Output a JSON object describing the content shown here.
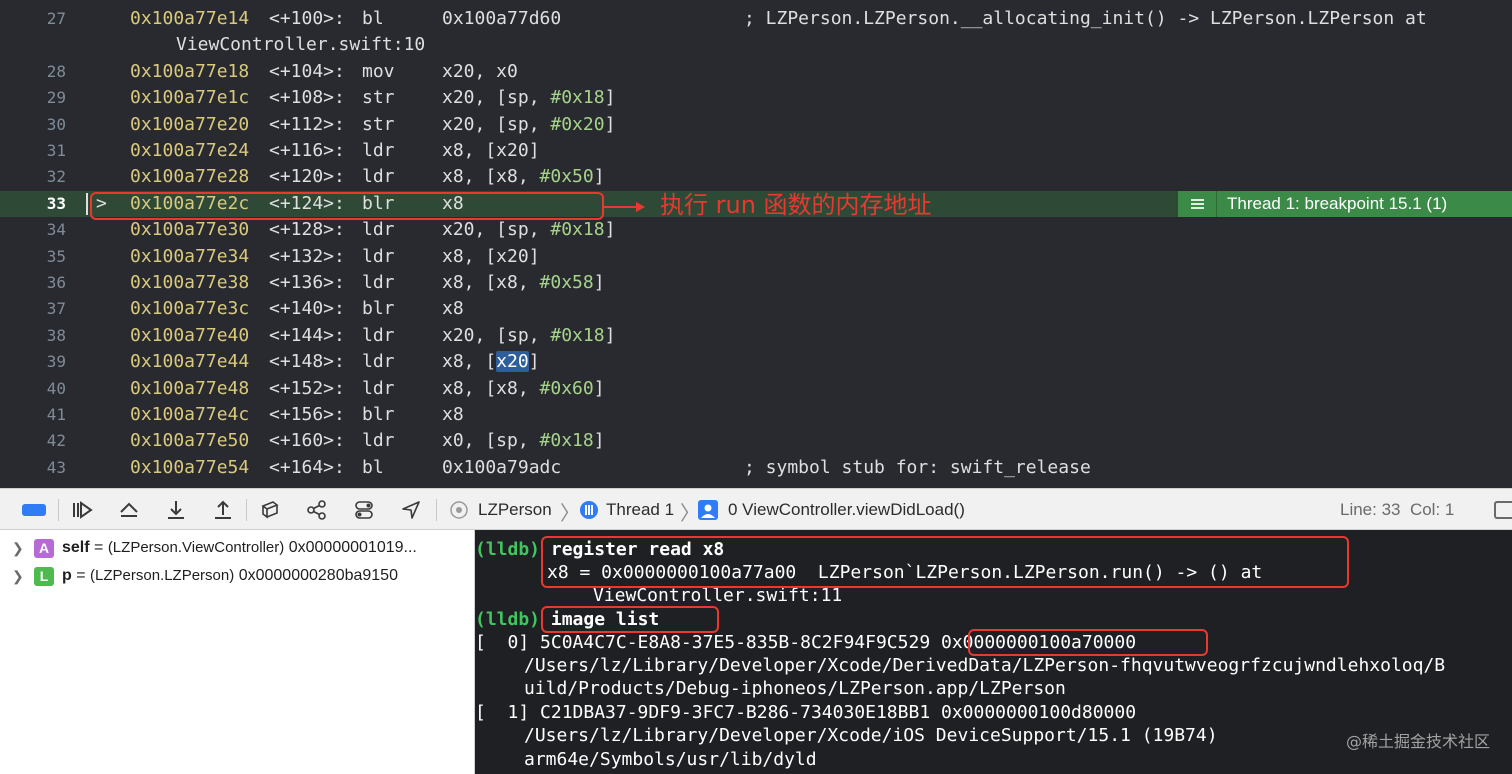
{
  "disassembly": {
    "lines": [
      {
        "num": "27",
        "addr": "0x100a77e14",
        "off": "<+100>:",
        "mn": "bl",
        "ops": [
          {
            "t": "0x100a77d60"
          }
        ],
        "comment": "; LZPerson.LZPerson.__allocating_init() -> LZPerson.LZPerson at",
        "continuation": "ViewController.swift:10"
      },
      {
        "num": "28",
        "addr": "0x100a77e18",
        "off": "<+104>:",
        "mn": "mov",
        "ops": [
          {
            "t": "x20, x0"
          }
        ]
      },
      {
        "num": "29",
        "addr": "0x100a77e1c",
        "off": "<+108>:",
        "mn": "str",
        "ops": [
          {
            "t": "x20, [sp, "
          },
          {
            "t": "#0x18",
            "c": "imm"
          },
          {
            "t": "]"
          }
        ]
      },
      {
        "num": "30",
        "addr": "0x100a77e20",
        "off": "<+112>:",
        "mn": "str",
        "ops": [
          {
            "t": "x20, [sp, "
          },
          {
            "t": "#0x20",
            "c": "imm"
          },
          {
            "t": "]"
          }
        ]
      },
      {
        "num": "31",
        "addr": "0x100a77e24",
        "off": "<+116>:",
        "mn": "ldr",
        "ops": [
          {
            "t": "x8, [x20]"
          }
        ]
      },
      {
        "num": "32",
        "addr": "0x100a77e28",
        "off": "<+120>:",
        "mn": "ldr",
        "ops": [
          {
            "t": "x8, [x8, "
          },
          {
            "t": "#0x50",
            "c": "imm"
          },
          {
            "t": "]"
          }
        ]
      },
      {
        "num": "33",
        "addr": "0x100a77e2c",
        "off": "<+124>:",
        "mn": "blr",
        "ops": [
          {
            "t": "x8"
          }
        ],
        "current": true,
        "arrow": ">"
      },
      {
        "num": "34",
        "addr": "0x100a77e30",
        "off": "<+128>:",
        "mn": "ldr",
        "ops": [
          {
            "t": "x20, [sp, "
          },
          {
            "t": "#0x18",
            "c": "imm"
          },
          {
            "t": "]"
          }
        ]
      },
      {
        "num": "35",
        "addr": "0x100a77e34",
        "off": "<+132>:",
        "mn": "ldr",
        "ops": [
          {
            "t": "x8, [x20]"
          }
        ]
      },
      {
        "num": "36",
        "addr": "0x100a77e38",
        "off": "<+136>:",
        "mn": "ldr",
        "ops": [
          {
            "t": "x8, [x8, "
          },
          {
            "t": "#0x58",
            "c": "imm"
          },
          {
            "t": "]"
          }
        ]
      },
      {
        "num": "37",
        "addr": "0x100a77e3c",
        "off": "<+140>:",
        "mn": "blr",
        "ops": [
          {
            "t": "x8"
          }
        ]
      },
      {
        "num": "38",
        "addr": "0x100a77e40",
        "off": "<+144>:",
        "mn": "ldr",
        "ops": [
          {
            "t": "x20, [sp, "
          },
          {
            "t": "#0x18",
            "c": "imm"
          },
          {
            "t": "]"
          }
        ]
      },
      {
        "num": "39",
        "addr": "0x100a77e44",
        "off": "<+148>:",
        "mn": "ldr",
        "ops": [
          {
            "t": "x8, ["
          },
          {
            "t": "x20",
            "c": "hl"
          },
          {
            "t": "]"
          }
        ]
      },
      {
        "num": "40",
        "addr": "0x100a77e48",
        "off": "<+152>:",
        "mn": "ldr",
        "ops": [
          {
            "t": "x8, [x8, "
          },
          {
            "t": "#0x60",
            "c": "imm"
          },
          {
            "t": "]"
          }
        ]
      },
      {
        "num": "41",
        "addr": "0x100a77e4c",
        "off": "<+156>:",
        "mn": "blr",
        "ops": [
          {
            "t": "x8"
          }
        ]
      },
      {
        "num": "42",
        "addr": "0x100a77e50",
        "off": "<+160>:",
        "mn": "ldr",
        "ops": [
          {
            "t": "x0, [sp, "
          },
          {
            "t": "#0x18",
            "c": "imm"
          },
          {
            "t": "]"
          }
        ]
      },
      {
        "num": "43",
        "addr": "0x100a77e54",
        "off": "<+164>:",
        "mn": "bl",
        "ops": [
          {
            "t": "0x100a79adc"
          }
        ],
        "comment": "; symbol stub for: swift_release"
      }
    ],
    "annotation": "执行 run 函数的内存地址",
    "thread_badge": "Thread 1: breakpoint 15.1 (1)"
  },
  "toolbar": {
    "icons": [
      "breakpoints-toggle-icon",
      "continue-icon",
      "step-over-icon",
      "step-into-icon",
      "step-out-icon",
      "debug-view-hierarchy-icon",
      "memory-graph-icon",
      "environment-overrides-icon",
      "simulate-location-icon"
    ],
    "breadcrumb": {
      "project": "LZPerson",
      "thread": "Thread 1",
      "frame": "0 ViewController.viewDidLoad()"
    },
    "line_col": "Line: 33  Col: 1"
  },
  "variables": [
    {
      "badge": "A",
      "badge_color": "#b76ad6",
      "name": "self",
      "type": "(LZPerson.ViewController)",
      "value": "0x00000001019..."
    },
    {
      "badge": "L",
      "badge_color": "#4cba4f",
      "name": "p",
      "type": "(LZPerson.LZPerson)",
      "value": "0x0000000280ba9150"
    }
  ],
  "console": {
    "prompt": "(lldb)",
    "cmd1": "register read x8",
    "out1": "x8 = 0x0000000100a77a00  LZPerson`LZPerson.LZPerson.run() -> () at",
    "out1b": "ViewController.swift:11",
    "cmd2": "image list",
    "img0_prefix": "[  0] 5C0A4C7C-E8A8-37E5-835B-8C2F94F9C529",
    "img0_addr": "0x0000000100a70000",
    "img0_path1": "/Users/lz/Library/Developer/Xcode/DerivedData/LZPerson-fhqvutwveogrfzcujwndlehxoloq/B",
    "img0_path2": "uild/Products/Debug-iphoneos/LZPerson.app/LZPerson",
    "img1": "[  1] C21DBA37-9DF9-3FC7-B286-734030E18BB1 0x0000000100d80000",
    "img1_path1": "/Users/lz/Library/Developer/Xcode/iOS DeviceSupport/15.1 (19B74)",
    "img1_path2": "arm64e/Symbols/usr/lib/dyld"
  },
  "watermark": "@稀土掘金技术社区"
}
